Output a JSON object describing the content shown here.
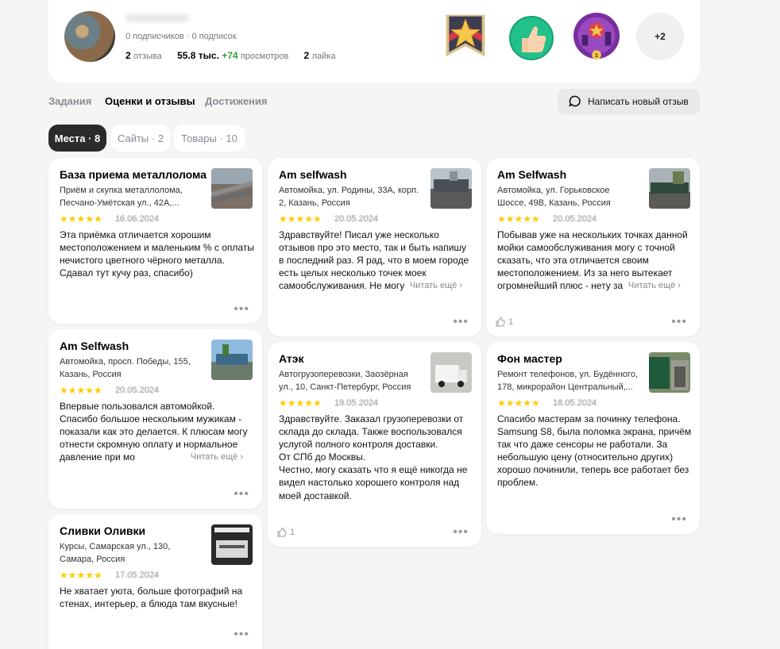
{
  "profile": {
    "followers": "0 подписчиков · 0 подписок",
    "reviews_count": "2",
    "reviews_label": "отзыва",
    "views_value": "55.8 тыс.",
    "views_delta": "+74",
    "views_label": "просмотров",
    "likes_count": "2",
    "likes_label": "лайка",
    "badge_city_count": "1",
    "badges_more": "+2"
  },
  "tabs": [
    {
      "label": "Задания"
    },
    {
      "label": "Оценки и отзывы"
    },
    {
      "label": "Достижения"
    }
  ],
  "write_review_label": "Написать новый отзыв",
  "chips": [
    {
      "label": "Места · 8"
    },
    {
      "label": "Сайты · 2"
    },
    {
      "label": "Товары · 10"
    }
  ],
  "reviews": [
    {
      "title": "База приема металлолома",
      "address": "Приём и скупка металлолома, Песчано-Умётская ул., 42А,...",
      "date": "16.06.2024",
      "text": "Эта приёмка отличается хорошим местоположением и маленьким % с оплаты нечистого цветного чёрного металла. Сдавал тут кучу раз, спасибо)"
    },
    {
      "title": "Am selfwash",
      "address": "Автомойка, ул. Родины, 33А, корп. 2, Казань, Россия",
      "date": "20.05.2024",
      "text": "Здравствуйте! Писал уже несколько отзывов про это место, так и быть напишу в последний раз. Я рад, что в моем городе есть целых несколько точек моек самообслуживания. Не могу",
      "read_more": "Читать ещё ›"
    },
    {
      "title": "Am Selfwash",
      "address": "Автомойка, ул. Горьковское Шоссе, 49В, Казань, Россия",
      "date": "20.05.2024",
      "text": "Побывав уже на нескольких точках данной мойки самообслуживания могу с точной сказать, что эта отличается своим местоположением. Из за него вытекает огромнейший плюс - нету за",
      "read_more": "Читать ещё ›",
      "likes": "1"
    },
    {
      "title": "Am Selfwash",
      "address": "Автомойка, просп. Победы, 155, Казань, Россия",
      "date": "20.05.2024",
      "text": "Впервые пользовался автомойкой. Спасибо большое нескольким мужикам - показали как это делается. К плюсам могу отнести скромную оплату и нормальное давление при мо",
      "read_more": "Читать ещё ›"
    },
    {
      "title": "Атэк",
      "address": "Автогрузоперевозки, Заозёрная ул., 10, Санкт-Петербург, Россия",
      "date": "19.05.2024",
      "text": "Здравствуйте. Заказал грузоперевозки от склада до склада. Также воспользовался услугой полного контроля доставки.\nОт СПб до Москвы.\nЧестно, могу сказать что я ещё никогда не видел настолько хорошего контроля над моей доставкой.",
      "likes": "1"
    },
    {
      "title": "Фон мастер",
      "address": "Ремонт телефонов, ул. Будённого, 178, микрорайон Центральный,...",
      "date": "18.05.2024",
      "text": "Спасибо мастерам за починку телефона. Samsung S8, была поломка экрана, причём так что даже сенсоры не работали. За небольшую цену (относительно других) хорошо починили, теперь все работает без проблем."
    },
    {
      "title": "Сливки Оливки",
      "address": "Курсы, Самарская ул., 130, Самара, Россия",
      "date": "17.05.2024",
      "text": "Не хватает уюта, больше фотографий на стенах, интерьер, а блюда там вкусные!"
    }
  ],
  "stars": "★★★★★",
  "dots": "•••",
  "colors": {
    "star": "#ffcc00",
    "accent_green": "#2e9e3a",
    "chip_active": "#2b2b2b"
  }
}
